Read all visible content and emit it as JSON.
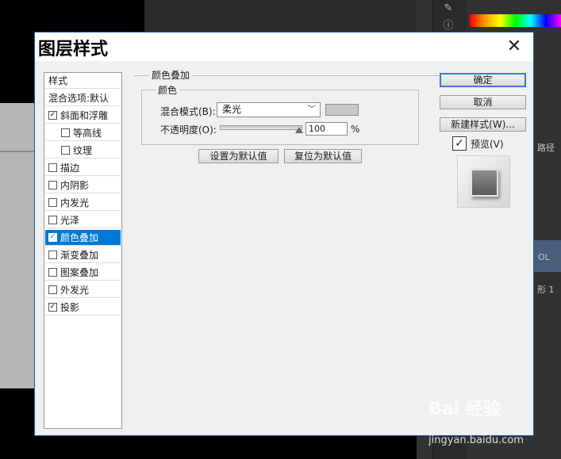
{
  "dialog": {
    "title": "图层样式",
    "close_glyph": "✕"
  },
  "style_list": {
    "header": "样式",
    "blend_options": "混合选项:默认",
    "items": [
      {
        "label": "斜面和浮雕",
        "checked": true,
        "indent": false
      },
      {
        "label": "等高线",
        "checked": false,
        "indent": true
      },
      {
        "label": "纹理",
        "checked": false,
        "indent": true
      },
      {
        "label": "描边",
        "checked": false,
        "indent": false
      },
      {
        "label": "内阴影",
        "checked": false,
        "indent": false
      },
      {
        "label": "内发光",
        "checked": false,
        "indent": false
      },
      {
        "label": "光泽",
        "checked": false,
        "indent": false
      },
      {
        "label": "颜色叠加",
        "checked": true,
        "indent": false,
        "selected": true
      },
      {
        "label": "渐变叠加",
        "checked": false,
        "indent": false
      },
      {
        "label": "图案叠加",
        "checked": false,
        "indent": false
      },
      {
        "label": "外发光",
        "checked": false,
        "indent": false
      },
      {
        "label": "投影",
        "checked": true,
        "indent": false
      }
    ]
  },
  "color_overlay": {
    "group_title": "颜色叠加",
    "color_title": "颜色",
    "blend_mode_label": "混合模式(B):",
    "blend_mode_value": "柔光",
    "overlay_color": "#c8c8c8",
    "opacity_label": "不透明度(O):",
    "opacity_value": "100",
    "opacity_unit": "%",
    "set_default": "设置为默认值",
    "reset_default": "复位为默认值"
  },
  "buttons": {
    "ok": "确定",
    "cancel": "取消",
    "new_style": "新建样式(W)..."
  },
  "preview": {
    "label": "预览(V)",
    "checked": true
  },
  "background": {
    "panel_labels": [
      "路径",
      "OL",
      "形 1"
    ]
  },
  "watermark": {
    "brand": "Bai 经验",
    "url": "jingyan.baidu.com"
  },
  "colors": {
    "accent": "#0078d7",
    "dialog_bg": "#f0f0f0",
    "app_bg": "#323232"
  }
}
